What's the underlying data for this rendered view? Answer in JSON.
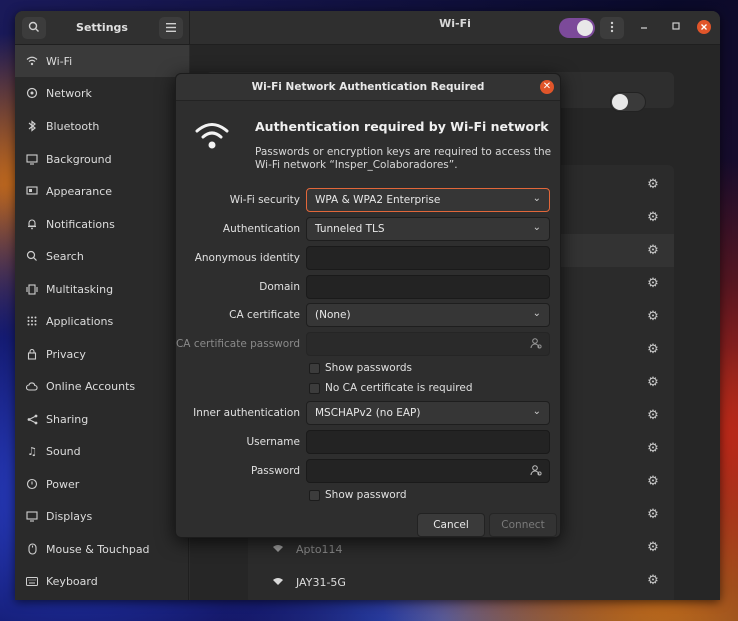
{
  "sidebar": {
    "title": "Settings",
    "items": [
      {
        "label": "Wi-Fi",
        "icon": "wifi-icon",
        "active": true
      },
      {
        "label": "Network",
        "icon": "network-icon"
      },
      {
        "label": "Bluetooth",
        "icon": "bluetooth-icon"
      },
      {
        "label": "Background",
        "icon": "background-icon"
      },
      {
        "label": "Appearance",
        "icon": "appearance-icon"
      },
      {
        "label": "Notifications",
        "icon": "bell-icon"
      },
      {
        "label": "Search",
        "icon": "search-icon"
      },
      {
        "label": "Multitasking",
        "icon": "multitasking-icon"
      },
      {
        "label": "Applications",
        "icon": "grid-icon",
        "chevron": true
      },
      {
        "label": "Privacy",
        "icon": "lock-icon",
        "chevron": true
      },
      {
        "label": "Online Accounts",
        "icon": "cloud-icon"
      },
      {
        "label": "Sharing",
        "icon": "share-icon"
      },
      {
        "label": "Sound",
        "icon": "music-icon"
      },
      {
        "label": "Power",
        "icon": "power-icon"
      },
      {
        "label": "Displays",
        "icon": "display-icon"
      },
      {
        "label": "Mouse & Touchpad",
        "icon": "mouse-icon"
      },
      {
        "label": "Keyboard",
        "icon": "keyboard-icon"
      }
    ]
  },
  "header": {
    "title": "Wi-Fi",
    "wifi_toggle_on": true
  },
  "networks": {
    "visible": [
      "Apto114",
      "JAY31-5G"
    ]
  },
  "dialog": {
    "title": "Wi-Fi Network Authentication Required",
    "heading": "Authentication required by Wi-Fi network",
    "description": "Passwords or encryption keys are required to access the Wi-Fi network “Insper_Colaboradores”.",
    "labels": {
      "wifi_security": "Wi-Fi security",
      "authentication": "Authentication",
      "anonymous_identity": "Anonymous identity",
      "domain": "Domain",
      "ca_certificate": "CA certificate",
      "ca_certificate_password": "CA certificate password",
      "inner_authentication": "Inner authentication",
      "username": "Username",
      "password": "Password"
    },
    "values": {
      "wifi_security": "WPA & WPA2 Enterprise",
      "authentication": "Tunneled TLS",
      "ca_certificate": "(None)",
      "inner_authentication": "MSCHAPv2 (no EAP)"
    },
    "checks": {
      "show_passwords": "Show passwords",
      "no_ca_required": "No CA certificate is required",
      "show_password": "Show password"
    },
    "buttons": {
      "cancel": "Cancel",
      "connect": "Connect"
    }
  },
  "colors": {
    "accent": "#e2673a",
    "toggle_on": "#7c4a9a",
    "close": "#e0552a"
  }
}
